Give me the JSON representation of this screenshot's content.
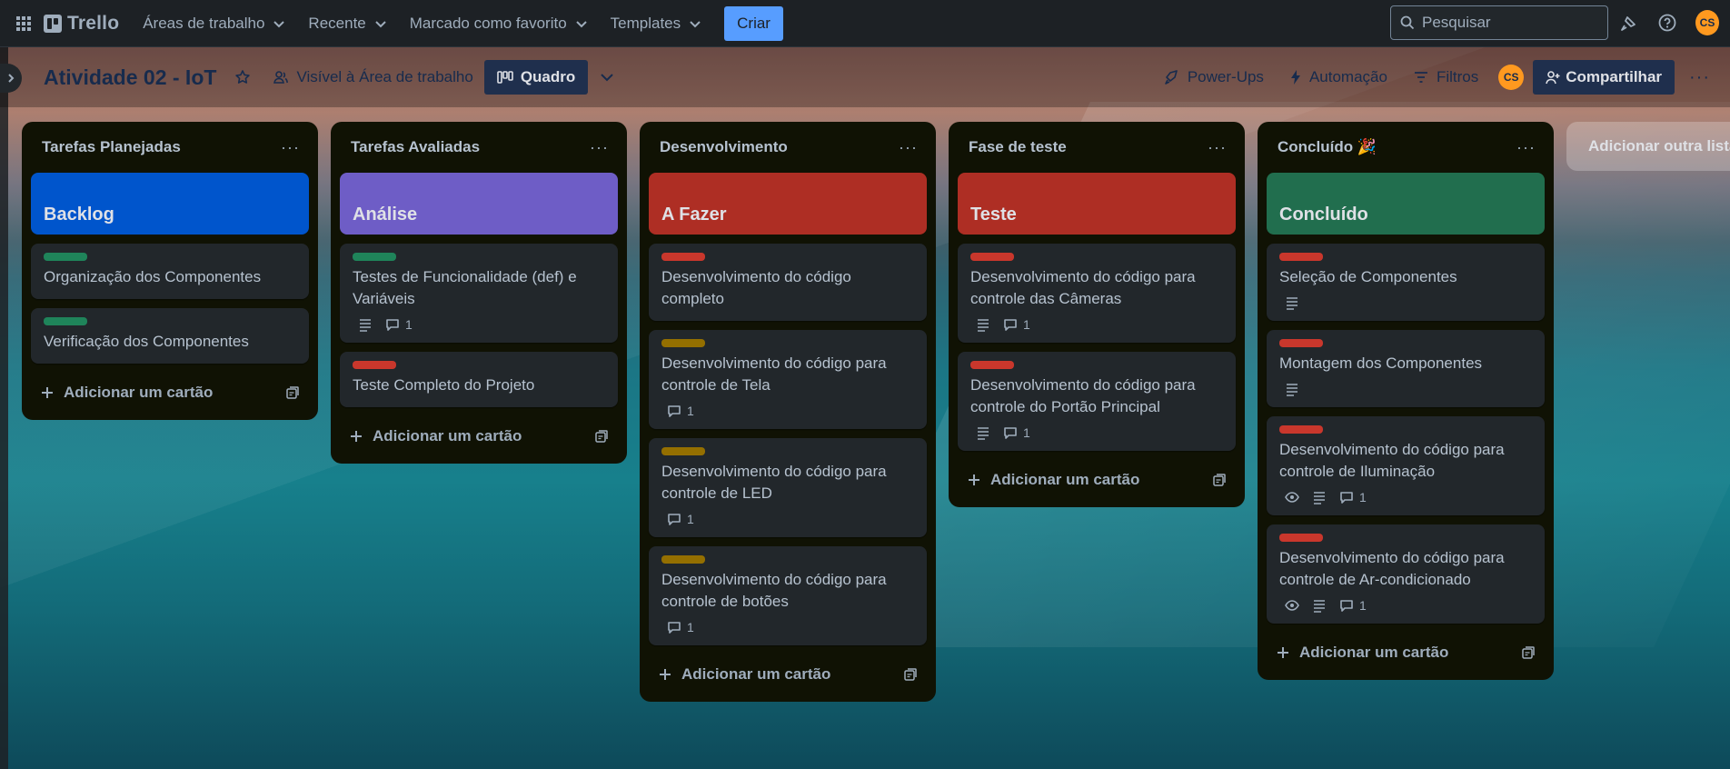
{
  "nav": {
    "brand": "Trello",
    "menus": [
      {
        "label": "Áreas de trabalho"
      },
      {
        "label": "Recente"
      },
      {
        "label": "Marcado como favorito"
      },
      {
        "label": "Templates"
      }
    ],
    "create_label": "Criar",
    "search_placeholder": "Pesquisar",
    "avatar_initials": "CS"
  },
  "board": {
    "title": "Atividade 02 - IoT",
    "visibility": "Visível à Área de trabalho",
    "view": "Quadro",
    "powerups": "Power-Ups",
    "automation": "Automação",
    "filters": "Filtros",
    "member_initials": "CS",
    "share": "Compartilhar",
    "add_list": "Adicionar outra lista"
  },
  "colors": {
    "label_green": "#1f845a",
    "label_red": "#c9372c",
    "label_yellow": "#946f00",
    "cover_blue": "#0055cc",
    "cover_purple": "#6e5dc6",
    "cover_red": "#ae2e24",
    "cover_green": "#216e4e"
  },
  "add_card_label": "Adicionar um cartão",
  "lists": [
    {
      "title": "Tarefas Planejadas",
      "cover": {
        "title": "Backlog",
        "color": "#0055cc"
      },
      "cards": [
        {
          "title": "Organização dos Componentes",
          "label": "#1f845a",
          "badges": []
        },
        {
          "title": "Verificação dos Componentes",
          "label": "#1f845a",
          "badges": []
        }
      ]
    },
    {
      "title": "Tarefas Avaliadas",
      "cover": {
        "title": "Análise",
        "color": "#6e5dc6"
      },
      "cards": [
        {
          "title": "Testes de Funcionalidade (def) e Variáveis",
          "label": "#1f845a",
          "badges": [
            "description",
            "comments"
          ],
          "comments": "1"
        },
        {
          "title": "Teste Completo do Projeto",
          "label": "#c9372c",
          "badges": []
        }
      ]
    },
    {
      "title": "Desenvolvimento",
      "cover": {
        "title": "A Fazer",
        "color": "#ae2e24"
      },
      "cards": [
        {
          "title": "Desenvolvimento do código completo",
          "label": "#c9372c",
          "badges": []
        },
        {
          "title": "Desenvolvimento do código para controle de Tela",
          "label": "#946f00",
          "badges": [
            "comments"
          ],
          "comments": "1"
        },
        {
          "title": "Desenvolvimento do código para controle de LED",
          "label": "#946f00",
          "badges": [
            "comments"
          ],
          "comments": "1"
        },
        {
          "title": "Desenvolvimento do código para controle de botões",
          "label": "#946f00",
          "badges": [
            "comments"
          ],
          "comments": "1"
        }
      ]
    },
    {
      "title": "Fase de teste",
      "cover": {
        "title": "Teste",
        "color": "#ae2e24"
      },
      "cards": [
        {
          "title": "Desenvolvimento do código para controle das Câmeras",
          "label": "#c9372c",
          "badges": [
            "description",
            "comments"
          ],
          "comments": "1"
        },
        {
          "title": "Desenvolvimento do código para controle do Portão Principal",
          "label": "#c9372c",
          "badges": [
            "description",
            "comments"
          ],
          "comments": "1"
        }
      ]
    },
    {
      "title": "Concluído 🎉",
      "cover": {
        "title": "Concluído",
        "color": "#216e4e"
      },
      "cards": [
        {
          "title": "Seleção de Componentes",
          "label": "#c9372c",
          "badges": [
            "description"
          ]
        },
        {
          "title": "Montagem dos Componentes",
          "label": "#c9372c",
          "badges": [
            "description"
          ]
        },
        {
          "title": "Desenvolvimento do código para controle de Iluminação",
          "label": "#c9372c",
          "badges": [
            "watch",
            "description",
            "comments"
          ],
          "comments": "1"
        },
        {
          "title": "Desenvolvimento do código para controle de Ar-condicionado",
          "label": "#c9372c",
          "badges": [
            "watch",
            "description",
            "comments"
          ],
          "comments": "1"
        }
      ]
    }
  ]
}
